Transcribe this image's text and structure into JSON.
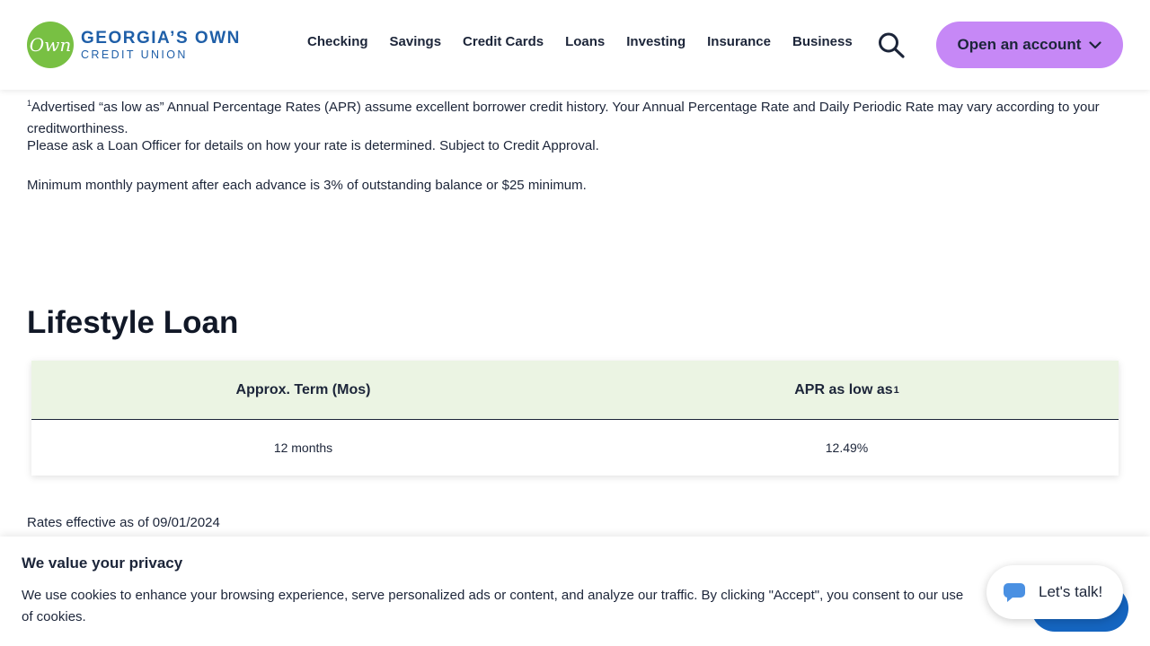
{
  "header": {
    "logo": {
      "badge": "Own",
      "line1": "GEORGIA’S OWN",
      "line2": "CREDIT UNION"
    },
    "nav": [
      {
        "label": "Checking"
      },
      {
        "label": "Savings"
      },
      {
        "label": "Credit Cards"
      },
      {
        "label": "Loans"
      },
      {
        "label": "Investing"
      },
      {
        "label": "Insurance"
      },
      {
        "label": "Business"
      }
    ],
    "search_icon": "search-icon",
    "cta": {
      "label": "Open an account",
      "icon": "chevron-down-icon",
      "color": "#c688f6"
    }
  },
  "disclaimer": {
    "footnote_marker": "1",
    "line1": "Advertised “as low as” Annual Percentage Rates (APR) assume excellent borrower credit history. Your Annual Percentage Rate and Daily Periodic Rate may vary according to your creditworthiness.",
    "line2": "Please ask a Loan Officer for details on how your rate is determined. Subject to Credit Approval.",
    "min_payment": "Minimum monthly payment after each advance is 3% of outstanding balance or $25 minimum."
  },
  "section": {
    "title": "Lifestyle Loan",
    "table": {
      "headers": [
        "Approx. Term (Mos)",
        "APR as low as"
      ],
      "header_footnote": "1",
      "rows": [
        [
          "12 months",
          "12.49%"
        ]
      ],
      "header_bg": "#ebf4e3"
    },
    "rates_effective": "Rates effective as of 09/01/2024"
  },
  "cookie_banner": {
    "title": "We value your privacy",
    "text": "We use cookies to enhance your browsing experience, serve personalized ads or content, and analyze our traffic. By clicking \"Accept\", you consent to our use of cookies."
  },
  "chat": {
    "label": "Let's talk!",
    "icon": "chat-bubble-icon",
    "color": "#4a90e2"
  },
  "colors": {
    "brand_green": "#78c043",
    "brand_blue": "#1f5fa8",
    "text": "#1c2539",
    "accept_blue": "#1565c0"
  }
}
